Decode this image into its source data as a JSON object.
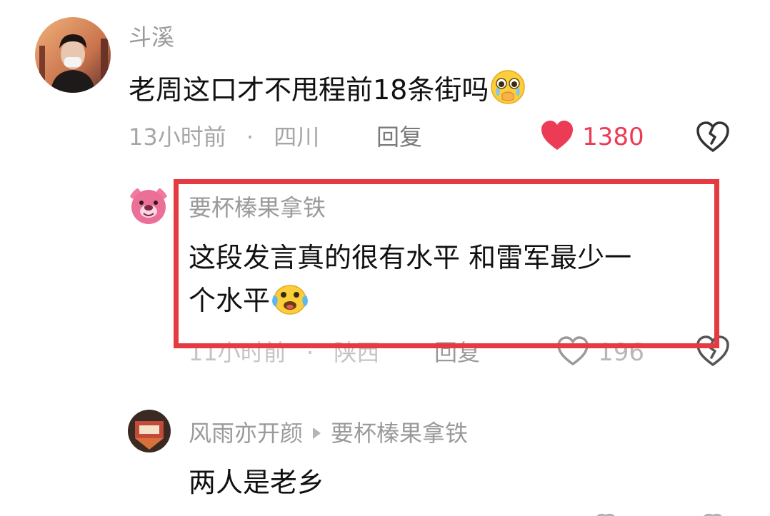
{
  "comments": [
    {
      "user": "斗溪",
      "text": "老周这口才不甩程前18条街吗",
      "emoji": "crying-pleading-emoji",
      "time": "13小时前",
      "location": "四川",
      "reply_label": "回复",
      "likes": "1380",
      "liked": true
    },
    {
      "user": "要杯榛果拿铁",
      "text_line1": "这段发言真的很有水平 和雷军最少一",
      "text_line2": "个水平",
      "emoji": "laugh-crying-emoji",
      "time": "11小时前",
      "location": "陕西",
      "reply_label": "回复",
      "likes": "196",
      "liked": false
    },
    {
      "user": "风雨亦开颜",
      "reply_to": "要杯榛果拿铁",
      "text": "两人是老乡"
    }
  ],
  "separator": "·",
  "colors": {
    "highlight_border": "#e53a3f",
    "like_active": "#ee3b55",
    "meta_text": "#a6a6a6"
  }
}
